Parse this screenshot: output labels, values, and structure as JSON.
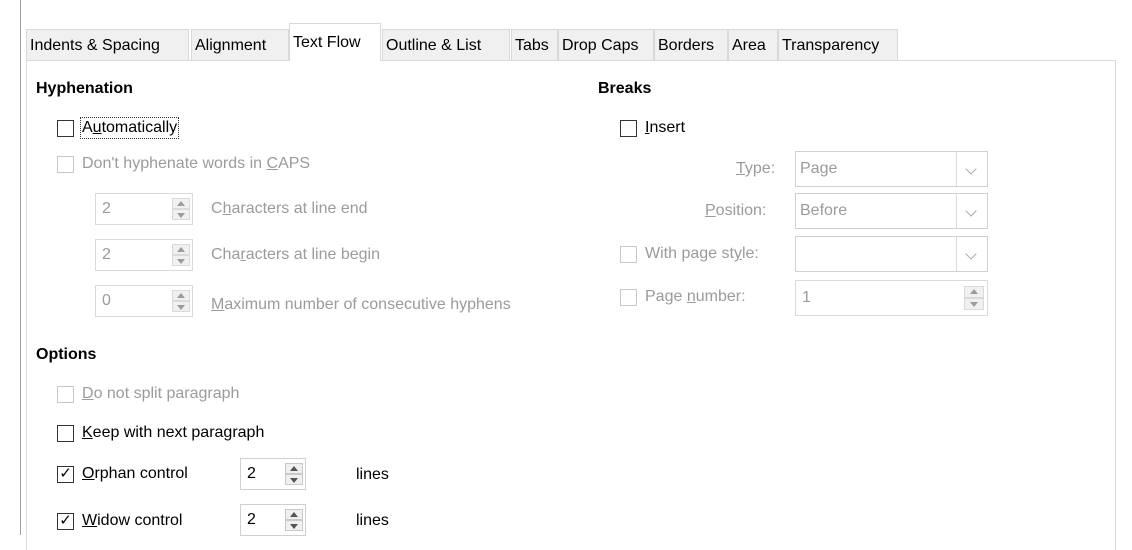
{
  "tabs": [
    "Indents & Spacing",
    "Alignment",
    "Text Flow",
    "Outline & List",
    "Tabs",
    "Drop Caps",
    "Borders",
    "Area",
    "Transparency"
  ],
  "active_tab": "Text Flow",
  "hyphenation": {
    "heading": "Hyphenation",
    "automatically": {
      "label": "Automatically",
      "checked": false
    },
    "dont_caps": {
      "label": "Don't hyphenate words in CAPS",
      "checked": false,
      "enabled": false
    },
    "line_end": {
      "value": "2",
      "label": "Characters at line end"
    },
    "line_begin": {
      "value": "2",
      "label": "Characters at line begin"
    },
    "max_hyphens": {
      "value": "0",
      "label": "Maximum number of consecutive hyphens"
    }
  },
  "breaks": {
    "heading": "Breaks",
    "insert": {
      "label": "Insert",
      "checked": false
    },
    "type": {
      "label": "Type:",
      "value": "Page"
    },
    "position": {
      "label": "Position:",
      "value": "Before"
    },
    "page_style": {
      "label": "With page style:",
      "value": ""
    },
    "page_number": {
      "label": "Page number:",
      "value": "1"
    }
  },
  "options": {
    "heading": "Options",
    "no_split": {
      "label": "Do not split paragraph",
      "checked": false,
      "enabled": false
    },
    "keep_next": {
      "label": "Keep with next paragraph",
      "checked": false
    },
    "orphan": {
      "label": "Orphan control",
      "checked": true,
      "value": "2",
      "unit": "lines"
    },
    "widow": {
      "label": "Widow control",
      "checked": true,
      "value": "2",
      "unit": "lines"
    }
  }
}
